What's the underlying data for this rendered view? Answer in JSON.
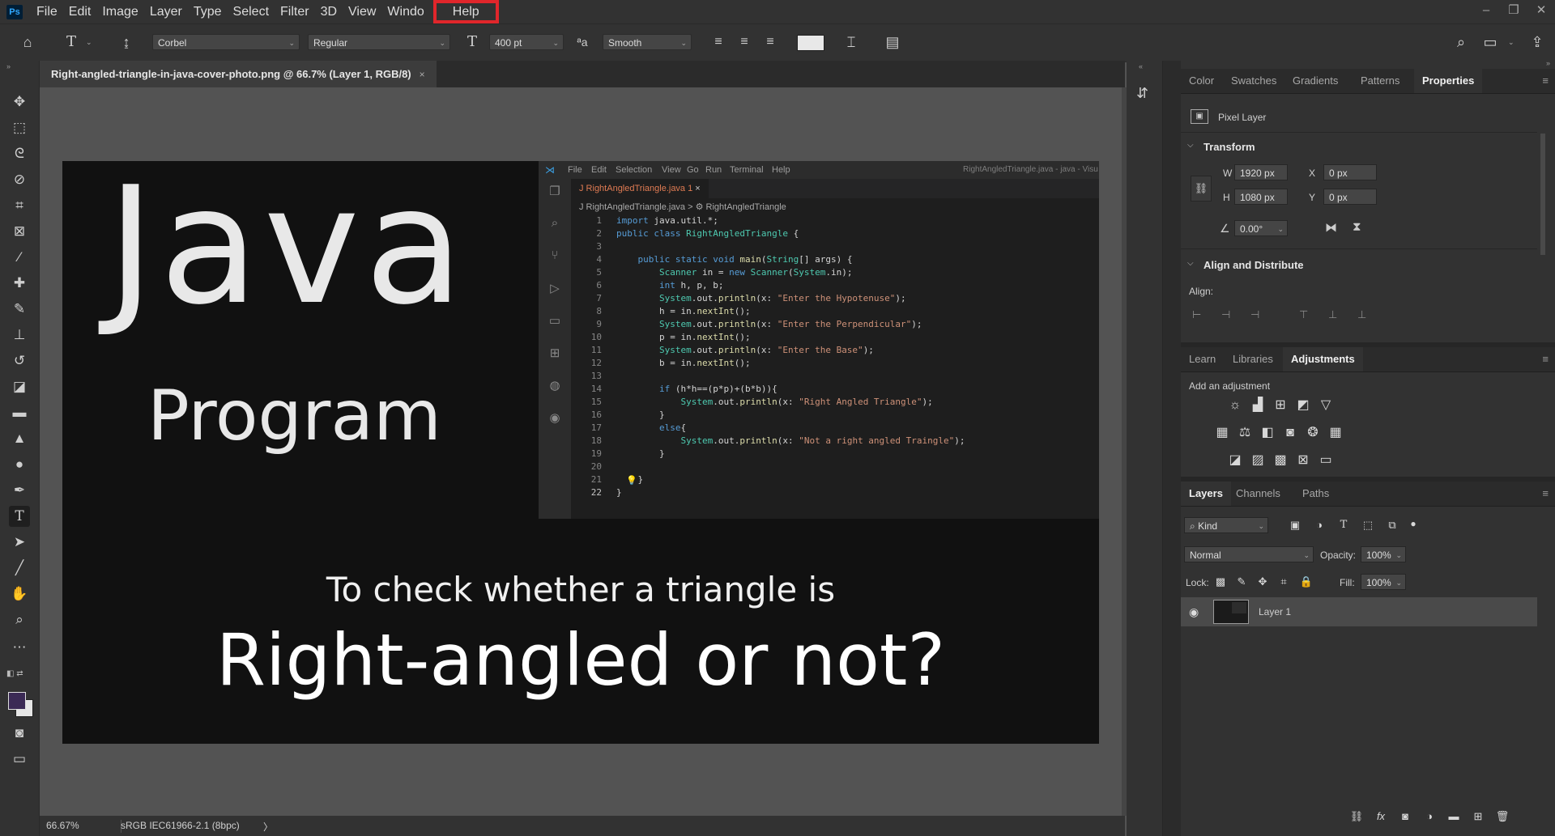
{
  "app": {
    "logo": "Ps"
  },
  "menu": [
    "File",
    "Edit",
    "Image",
    "Layer",
    "Type",
    "Select",
    "Filter",
    "3D",
    "View",
    "Windo",
    "Help"
  ],
  "highlighted_menu": "Help",
  "window_controls": {
    "minimize": "–",
    "restore": "❐",
    "close": "✕"
  },
  "options_bar": {
    "font_family": "Corbel",
    "font_style": "Regular",
    "font_size": "400 pt",
    "antialias_label": "ªa",
    "antialias": "Smooth"
  },
  "document": {
    "tab_title": "Right-angled-triangle-in-java-cover-photo.png @ 66.7% (Layer 1, RGB/8)",
    "tab_close": "×",
    "zoom": "66.67%",
    "color_profile": "sRGB IEC61966-2.1 (8bpc)",
    "status_arrow": "〉"
  },
  "artwork": {
    "title": "Java",
    "subtitle": "Program",
    "line1": "To check whether a triangle is",
    "line2": "Right-angled or not?",
    "vscode": {
      "menu": [
        "File",
        "Edit",
        "Selection",
        "View",
        "Go",
        "Run",
        "Terminal",
        "Help"
      ],
      "window_title": "RightAngledTriangle.java - java - Visu",
      "tab_label": "J RightAngledTriangle.java 1",
      "tab_close": "×",
      "breadcrumb": "J RightAngledTriangle.java > ⚙ RightAngledTriangle",
      "lines": [
        "import java.util.*;",
        "public class RightAngledTriangle {",
        "",
        "    public static void main(String[] args) {",
        "        Scanner in = new Scanner(System.in);",
        "        int h, p, b;",
        "        System.out.println(x: \"Enter the Hypotenuse\");",
        "        h = in.nextInt();",
        "        System.out.println(x: \"Enter the Perpendicular\");",
        "        p = in.nextInt();",
        "        System.out.println(x: \"Enter the Base\");",
        "        b = in.nextInt();",
        "",
        "        if (h*h==(p*p)+(b*b)){",
        "            System.out.println(x: \"Right Angled Triangle\");",
        "        }",
        "        else{",
        "            System.out.println(x: \"Not a right angled Traingle\");",
        "        }",
        "",
        "    }",
        "}"
      ]
    }
  },
  "panels": {
    "top_tabs": [
      "Color",
      "Swatches",
      "Gradients",
      "Patterns",
      "Properties"
    ],
    "active_top_tab": "Properties",
    "pixel_layer": "Pixel Layer",
    "transform": {
      "header": "Transform",
      "w_label": "W",
      "w": "1920 px",
      "h_label": "H",
      "h": "1080 px",
      "x_label": "X",
      "x": "0 px",
      "y_label": "Y",
      "y": "0 px",
      "angle": "0.00°"
    },
    "align": {
      "header": "Align and Distribute",
      "label": "Align:"
    },
    "mid_tabs": [
      "Learn",
      "Libraries",
      "Adjustments"
    ],
    "active_mid_tab": "Adjustments",
    "add_adjustment": "Add an adjustment",
    "layer_tabs": [
      "Layers",
      "Channels",
      "Paths"
    ],
    "active_layer_tab": "Layers",
    "filter_kind": "Kind",
    "blend_mode": "Normal",
    "opacity_label": "Opacity:",
    "opacity": "100%",
    "lock_label": "Lock:",
    "fill_label": "Fill:",
    "fill": "100%",
    "layer_name": "Layer 1"
  }
}
